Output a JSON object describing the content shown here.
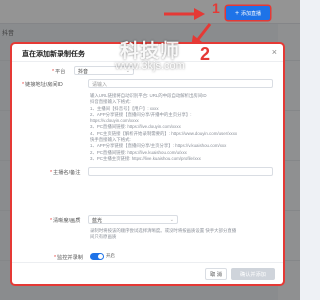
{
  "background": {
    "tab_label": "抖音"
  },
  "header": {
    "add_button_label": "添加直播",
    "add_button_icon": "plus-icon"
  },
  "annotations": {
    "marker_1": "1",
    "marker_2": "2",
    "color": "#e53935"
  },
  "watermark": {
    "text": "科技师",
    "url": "www.3kjs.com"
  },
  "dialog": {
    "title": "直在添加新录制任务",
    "close_icon": "close-icon",
    "fields": {
      "platform": {
        "label": "平台",
        "value": "抖音"
      },
      "link": {
        "label": "链接地址/房间ID",
        "placeholder": "请输入"
      },
      "streamer": {
        "label": "主播名/备注",
        "placeholder": ""
      },
      "quality": {
        "label": "清晰度/画质",
        "value": "蓝光"
      },
      "autorecord": {
        "label": "监控并录制",
        "toggle_text": "开启"
      }
    },
    "help_lines": [
      "输入URL链接将自动识别平台: URL的中段自动解析出房间ID",
      "抖音直接输入下格式:",
      "1、主播间【抖音号】【用户】: xxxx",
      "2、APP分享链接【直播间分享/开播中的主页分享】:",
      "https://v.douyin.com/xxxx",
      "3、PC直播间链接: https://live.douyin.com/xxxx",
      "4、PC主页链接【解析开始录制需要的】: https://www.douyin.com/user/xxxx",
      "快手直接输入下格式:",
      "1、APP分享链接【直播间分享/主页分享】: https://v.kuaishou.com/xxx",
      "2、PC直播间链接: https://live.kuaishou.com/u/xxx",
      "3、PC主播主页链接: https://live.kuaishou.com/profile/xxx"
    ],
    "quality_help": [
      "录制时将按该的顺序尝试选择清晰度。或没时将按画质设置 快手大部分直播",
      "间只有原画质"
    ],
    "footer": {
      "cancel_label": "取 消",
      "confirm_label": "确认并添加"
    }
  }
}
